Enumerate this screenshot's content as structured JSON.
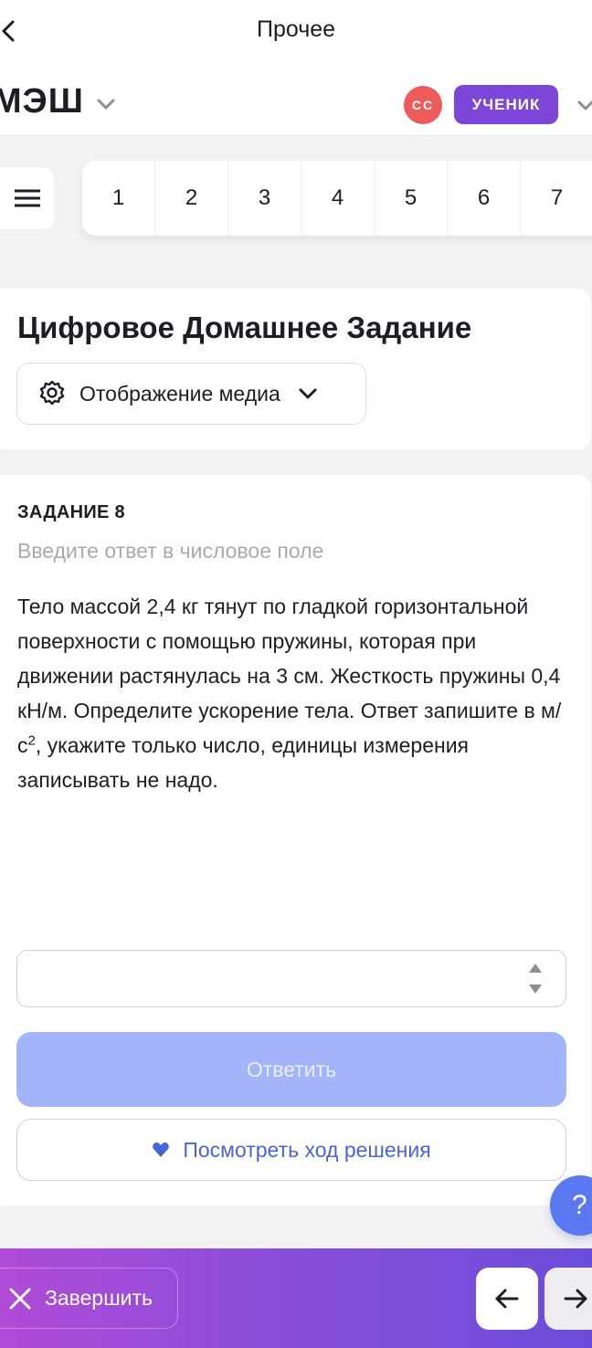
{
  "topbar": {
    "title": "Прочее"
  },
  "header": {
    "logo": "МЭШ",
    "avatar_initials": "СС",
    "role": "УЧЕНИК"
  },
  "nav": {
    "menu_icon": "hamburger-icon",
    "numbers": [
      "1",
      "2",
      "3",
      "4",
      "5",
      "6",
      "7"
    ]
  },
  "page": {
    "title": "Цифровое Домашнее Задание",
    "media_button": "Отображение медиа"
  },
  "task": {
    "label": "ЗАДАНИЕ 8",
    "hint": "Введите ответ в числовое поле",
    "text_before_sup": "Тело массой 2,4 кг тянут по гладкой горизонтальной поверхности с помощью пружины, которая при движении растянулась на 3 см. Жесткость пружины 0,4 кН/м. Определите ускорение тела. Ответ запишите в м/с",
    "text_sup": "2",
    "text_after_sup": ", укажите только число, единицы измерения записывать не надо.",
    "input_value": "",
    "answer_button": "Ответить",
    "solution_button": "Посмотреть ход решения"
  },
  "help": {
    "label": "?"
  },
  "bottom": {
    "finish": "Завершить"
  },
  "colors": {
    "accent_purple": "#7d45d8",
    "avatar_red": "#ee5b5b",
    "answer_disabled": "#a4b4f8",
    "link_blue": "#4a63d8",
    "help_blue": "#5b78f0"
  }
}
